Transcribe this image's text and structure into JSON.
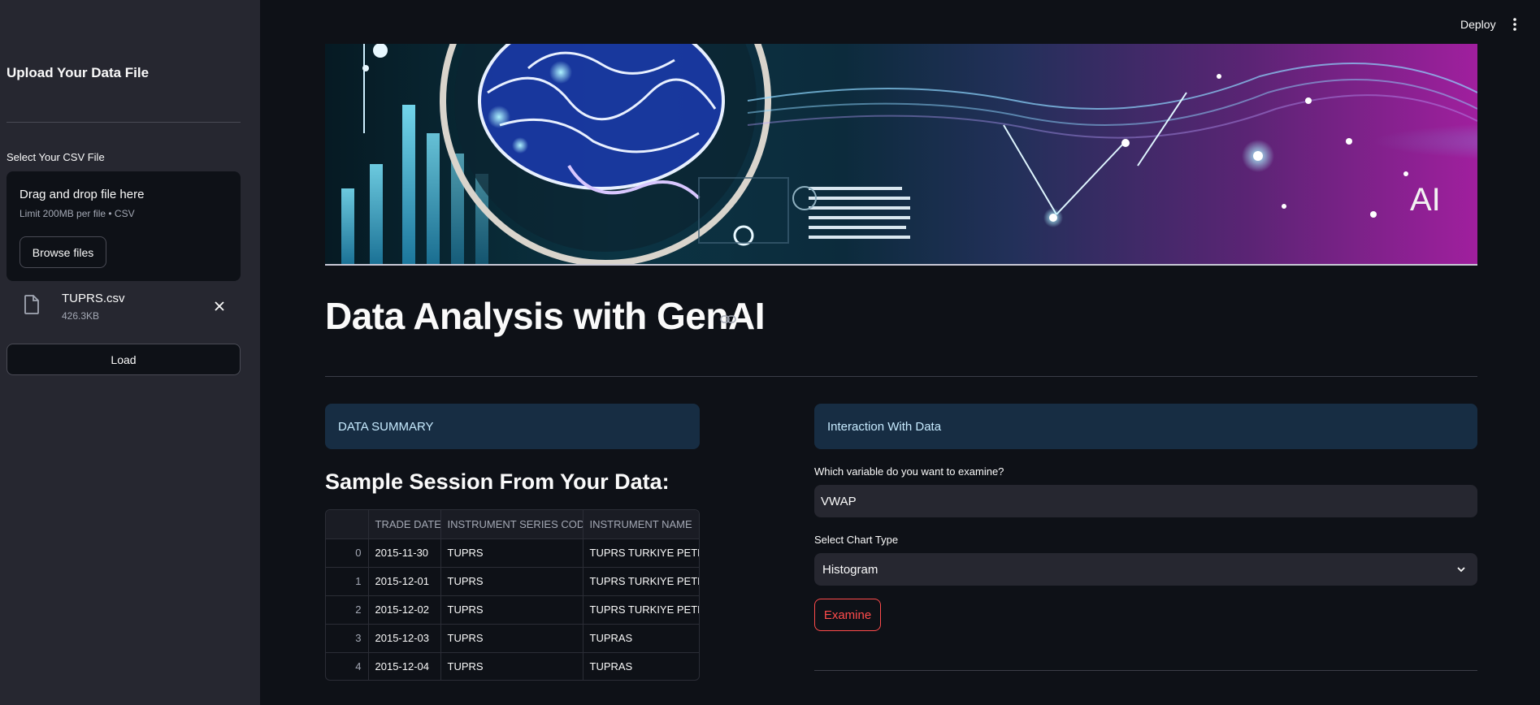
{
  "header": {
    "deploy_label": "Deploy"
  },
  "sidebar": {
    "title": "Upload Your Data File",
    "upload_label": "Select Your CSV File",
    "dropzone": {
      "title": "Drag and drop file here",
      "limit": "Limit 200MB per file • CSV",
      "browse_label": "Browse files"
    },
    "file": {
      "name": "TUPRS.csv",
      "size": "426.3KB"
    },
    "load_label": "Load"
  },
  "banner": {
    "text": "AI"
  },
  "main": {
    "title": "Data Analysis with GenAI",
    "summary_box": "DATA SUMMARY",
    "sample_heading": "Sample Session From Your Data:",
    "table": {
      "columns": [
        "",
        "TRADE DATE",
        "INSTRUMENT SERIES CODE",
        "INSTRUMENT NAME"
      ],
      "rows": [
        [
          "0",
          "2015-11-30",
          "TUPRS",
          "TUPRS TURKIYE PETROLI"
        ],
        [
          "1",
          "2015-12-01",
          "TUPRS",
          "TUPRS TURKIYE PETROLI"
        ],
        [
          "2",
          "2015-12-02",
          "TUPRS",
          "TUPRS TURKIYE PETROLI"
        ],
        [
          "3",
          "2015-12-03",
          "TUPRS",
          "TUPRAS"
        ],
        [
          "4",
          "2015-12-04",
          "TUPRS",
          "TUPRAS"
        ]
      ]
    },
    "interaction_box": "Interaction With Data",
    "variable_label": "Which variable do you want to examine?",
    "variable_value": "VWAP",
    "chart_type_label": "Select Chart Type",
    "chart_type_value": "Histogram",
    "examine_label": "Examine"
  },
  "colors": {
    "background": "#0e1117",
    "sidebar": "#262730",
    "info_box": "#172d43",
    "info_text": "#c7ebff",
    "accent": "#ff4b4b"
  }
}
